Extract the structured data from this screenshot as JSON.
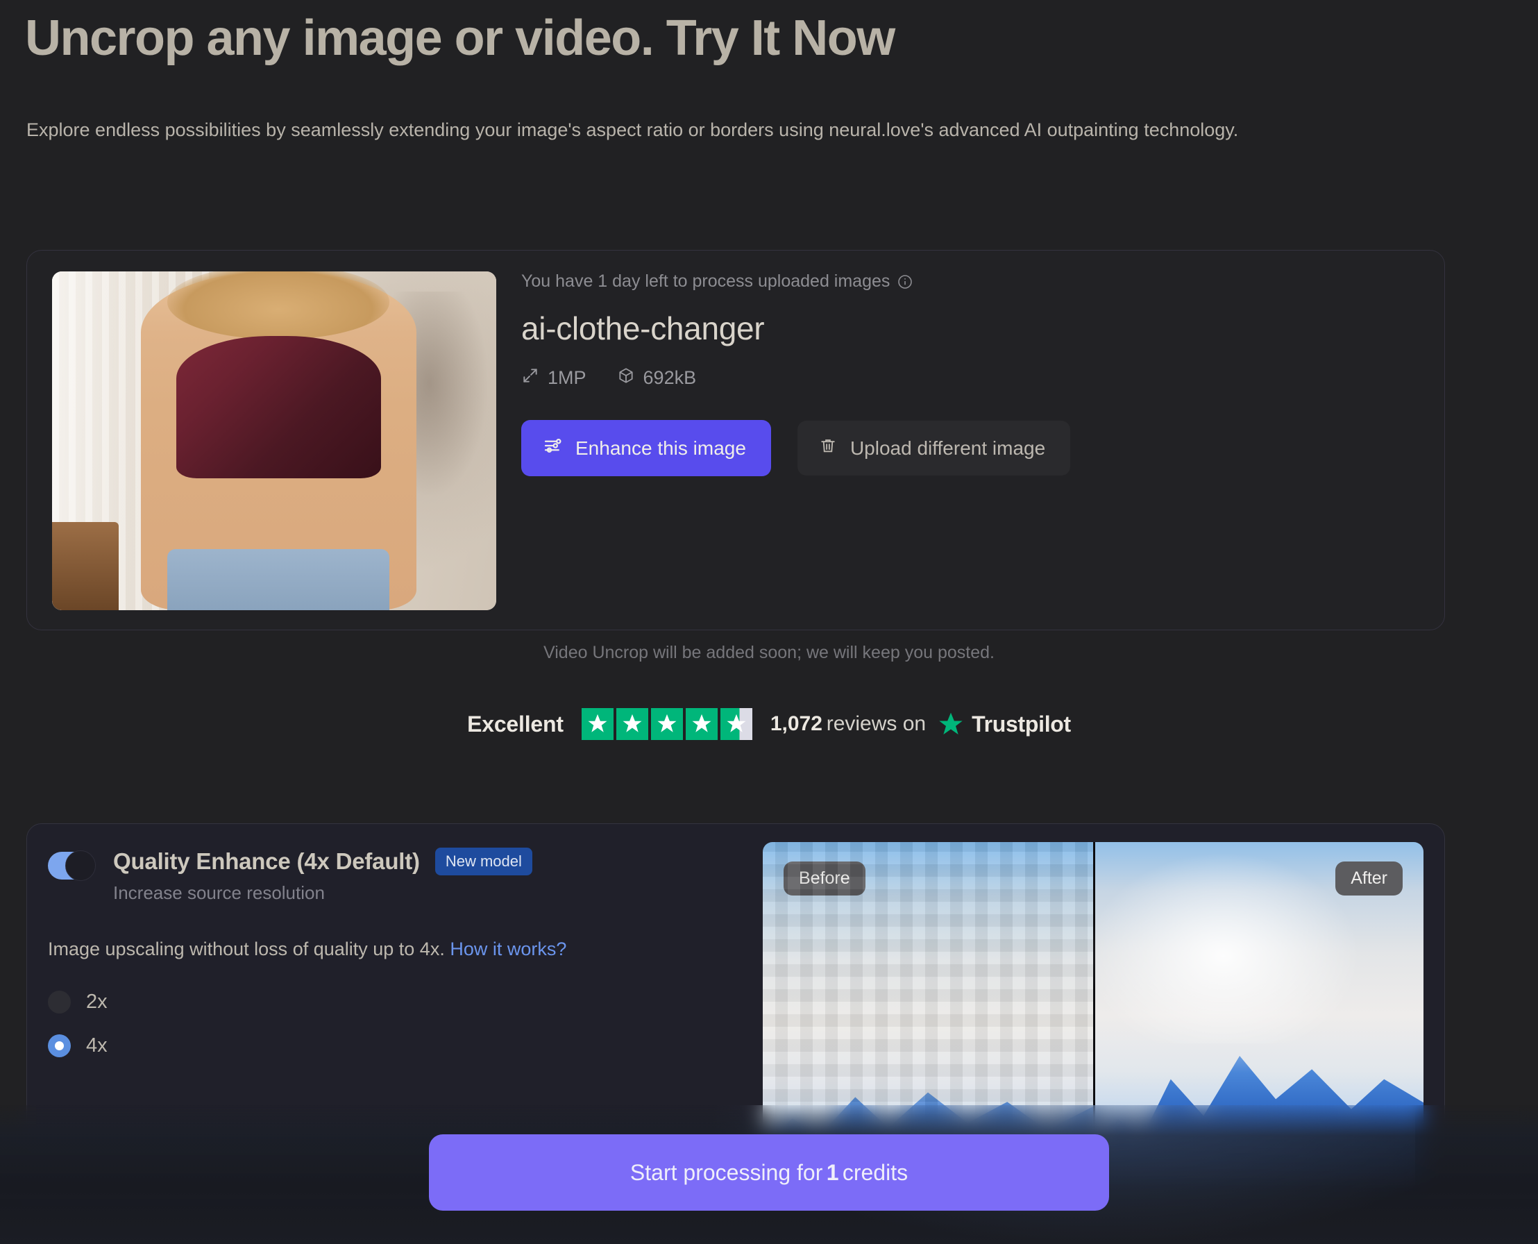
{
  "hero": {
    "title": "Uncrop any image or video. Try It Now",
    "subtitle": "Explore endless possibilities by seamlessly extending your image's aspect ratio or borders using neural.love's advanced AI outpainting technology."
  },
  "upload_card": {
    "notice": "You have 1 day left to process uploaded images",
    "file_name": "ai-clothe-changer",
    "stats": [
      {
        "icon": "resize-icon",
        "value": "1MP"
      },
      {
        "icon": "cube-icon",
        "value": "692kB"
      }
    ],
    "primary_button": "Enhance this image",
    "secondary_button": "Upload different image"
  },
  "note": "Video Uncrop will be added soon; we will keep you posted.",
  "trustpilot": {
    "rating_word": "Excellent",
    "stars_filled": 4.6,
    "stars_total": 5,
    "review_count": "1,072",
    "reviews_label": "reviews on",
    "brand": "Trustpilot",
    "star_color": "#00b67a",
    "empty_star_color": "#dcdce6"
  },
  "options": {
    "toggle_on": true,
    "title": "Quality Enhance (4x Default)",
    "badge": "New model",
    "subtitle": "Increase source resolution",
    "description": "Image upscaling without loss of quality up to 4x.",
    "link": "How it works?",
    "link_color": "#6b95ed",
    "scale_options": [
      {
        "label": "2x",
        "selected": false
      },
      {
        "label": "4x",
        "selected": true
      }
    ],
    "preview": {
      "before_label": "Before",
      "after_label": "After"
    }
  },
  "cta": {
    "prefix": "Start processing for",
    "credits": "1",
    "suffix": "credits",
    "color": "#7c6cf7"
  }
}
